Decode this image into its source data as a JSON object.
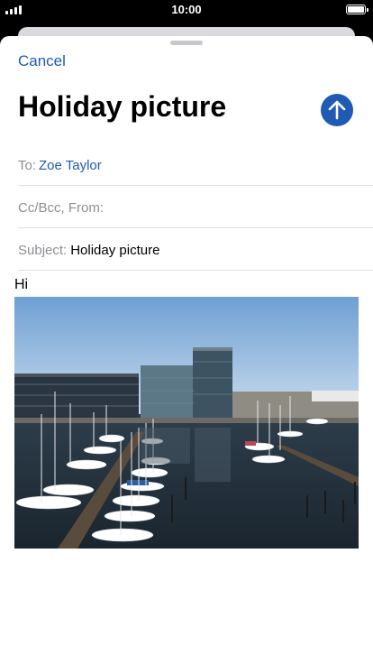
{
  "status_bar": {
    "time": "10:00"
  },
  "compose": {
    "cancel_label": "Cancel",
    "title": "Holiday picture",
    "to_label": "To:",
    "to_recipient": "Zoe Taylor",
    "cc_label": "Cc/Bcc, From:",
    "subject_label": "Subject:",
    "subject_value": "Holiday picture",
    "body_text": "Hi"
  },
  "colors": {
    "accent": "#1f5bb5"
  }
}
